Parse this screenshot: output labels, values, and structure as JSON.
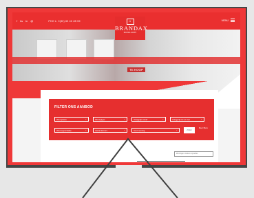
{
  "topbar": {
    "social_icons": [
      "f",
      "tw",
      "in",
      "@"
    ],
    "phone": "PHO L: 0(30) 63 40 4B 59",
    "menu_label": "MENU"
  },
  "logo": {
    "name": "BRANDAX",
    "tagline": "MAKELAARS"
  },
  "hero": {
    "sign_text": "TE KOOP"
  },
  "filter": {
    "title": "FILTER ONS AANBOD",
    "selects": [
      {
        "label": "Woonplaats"
      },
      {
        "label": "Woningtype"
      },
      {
        "label": "Vraagprijs vanaf"
      },
      {
        "label": "Vraagprijs tot en met"
      },
      {
        "label": "Woonoppervlakte"
      },
      {
        "label": "Aantal kamers"
      },
      {
        "label": "Soort woning"
      }
    ],
    "zoek_label": "ZOEK",
    "meer_label": "Meer filters"
  },
  "search": {
    "placeholder": "Woningen zoeken op adres"
  },
  "colors": {
    "brand_red": "#ea2f2f",
    "bezel": "#454545",
    "background": "#e7e7e7"
  }
}
